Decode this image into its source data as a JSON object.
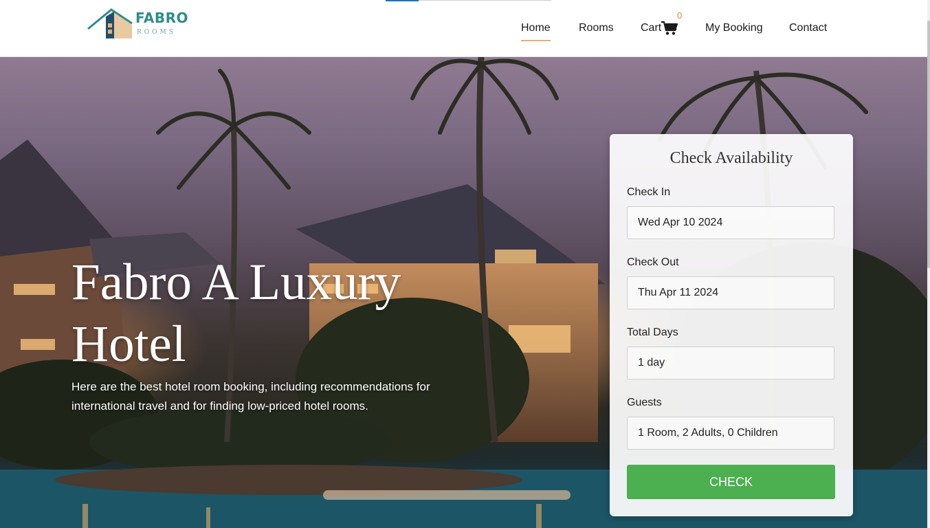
{
  "brand": {
    "name": "FABRO",
    "sub": "ROOMS"
  },
  "nav": {
    "home": "Home",
    "rooms": "Rooms",
    "cart": "Cart",
    "cart_count": "0",
    "booking": "My Booking",
    "contact": "Contact"
  },
  "hero": {
    "title": "Fabro A Luxury Hotel",
    "subtitle": "Here are the best hotel room booking, including recommendations for international travel and for finding low-priced hotel rooms."
  },
  "availability": {
    "title": "Check Availability",
    "check_in_label": "Check In",
    "check_in_value": "Wed Apr 10 2024",
    "check_out_label": "Check Out",
    "check_out_value": "Thu Apr 11 2024",
    "total_days_label": "Total Days",
    "total_days_value": "1 day",
    "guests_label": "Guests",
    "guests_value": "1 Room, 2 Adults, 0 Children",
    "button": "CHECK"
  },
  "colors": {
    "accent_teal": "#2f8c8a",
    "nav_underline": "#e0b07b",
    "cart_badge": "#e8822e",
    "check_button": "#4caf50"
  },
  "icons": {
    "cart": "shopping-cart-icon",
    "logo": "house-logo-icon"
  }
}
